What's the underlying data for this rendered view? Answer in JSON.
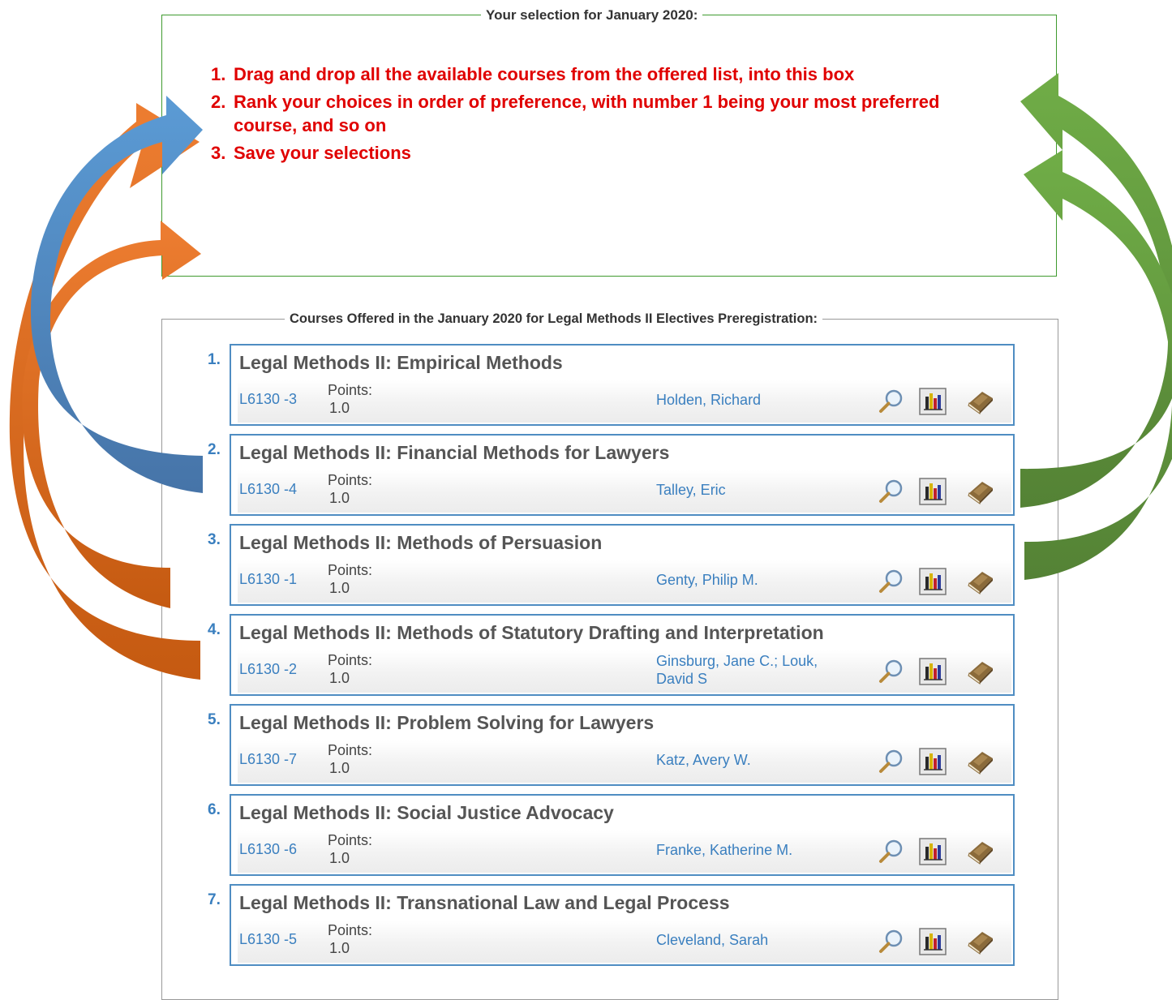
{
  "selection": {
    "legend": "Your selection for January 2020:",
    "instructions": [
      {
        "num": "1.",
        "text": "Drag and drop all the available courses from the offered list, into this box"
      },
      {
        "num": "2.",
        "text": "Rank your choices in order of preference, with number 1 being your most preferred course, and so on"
      },
      {
        "num": "3.",
        "text": "Save your selections"
      }
    ]
  },
  "courses": {
    "legend": "Courses Offered in the January 2020 for Legal Methods II Electives Preregistration:",
    "points_label": "Points:",
    "items": [
      {
        "rank": "1.",
        "title": "Legal Methods II: Empirical Methods",
        "code": "L6130 -3",
        "points": "1.0",
        "instructor": "Holden, Richard"
      },
      {
        "rank": "2.",
        "title": "Legal Methods II: Financial Methods for Lawyers",
        "code": "L6130 -4",
        "points": "1.0",
        "instructor": "Talley, Eric"
      },
      {
        "rank": "3.",
        "title": "Legal Methods II: Methods of Persuasion",
        "code": "L6130 -1",
        "points": "1.0",
        "instructor": "Genty, Philip M."
      },
      {
        "rank": "4.",
        "title": "Legal Methods II: Methods of Statutory Drafting and Interpretation",
        "code": "L6130 -2",
        "points": "1.0",
        "instructor": "Ginsburg, Jane C.;  Louk, David S"
      },
      {
        "rank": "5.",
        "title": "Legal Methods II: Problem Solving for Lawyers",
        "code": "L6130 -7",
        "points": "1.0",
        "instructor": "Katz, Avery W."
      },
      {
        "rank": "6.",
        "title": "Legal Methods II: Social Justice Advocacy",
        "code": "L6130 -6",
        "points": "1.0",
        "instructor": "Franke, Katherine M."
      },
      {
        "rank": "7.",
        "title": "Legal Methods II: Transnational Law and Legal Process",
        "code": "L6130 -5",
        "points": "1.0",
        "instructor": "Cleveland, Sarah"
      }
    ]
  },
  "icons": [
    "magnifier-icon",
    "bar-chart-icon",
    "book-icon"
  ],
  "colors": {
    "instruction_red": "#e00000",
    "link_blue": "#3a7fbf",
    "card_border": "#4f8dc2",
    "selection_border": "#3f9a2f",
    "arrow_orange": "#ed7d31",
    "arrow_blue": "#5b9bd5",
    "arrow_green": "#70ad47"
  }
}
